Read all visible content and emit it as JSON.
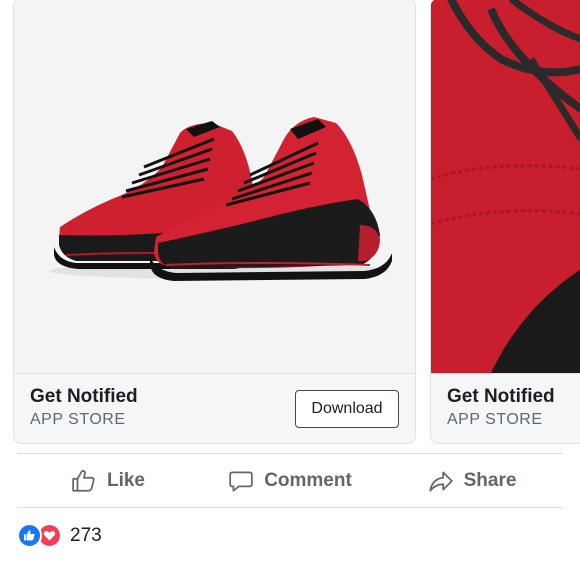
{
  "ad_cards": [
    {
      "image_icon": "red-black-sneakers-photo",
      "title": "Get Notified",
      "subtitle": "APP STORE",
      "cta_label": "Download"
    },
    {
      "image_icon": "red-sneaker-closeup-photo",
      "title": "Get Notified",
      "subtitle": "APP STORE"
    }
  ],
  "actions": {
    "like_label": "Like",
    "comment_label": "Comment",
    "share_label": "Share"
  },
  "reactions": {
    "icons": [
      "like-reaction-icon",
      "love-reaction-icon"
    ],
    "count": "273"
  },
  "colors": {
    "like_blue": "#1877f2",
    "love_red": "#f33e58",
    "action_gray": "#606770",
    "shoe_red": "#ce2130"
  }
}
